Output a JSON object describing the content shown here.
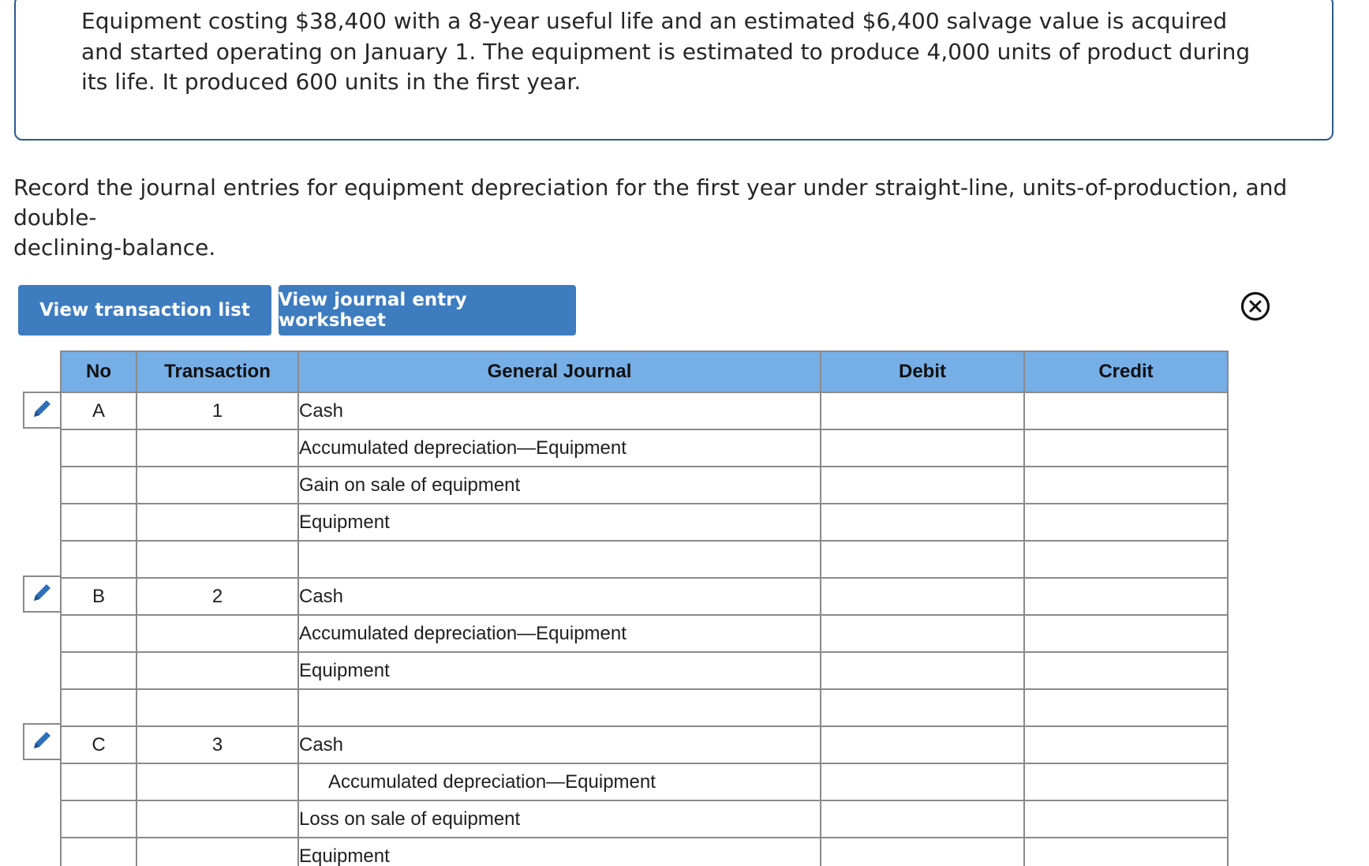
{
  "problem": {
    "lines": [
      "Equipment costing $38,400 with a 8-year useful life and an estimated $6,400 salvage value is acquired",
      "and started operating on January 1. The equipment is estimated to produce 4,000 units of product during",
      "its life. It produced 600 units in the first year."
    ]
  },
  "instruction": {
    "lines": [
      "Record the journal entries for equipment depreciation for the first year under straight-line, units-of-production, and double-",
      "declining-balance."
    ]
  },
  "buttons": {
    "transaction_list": "View transaction list",
    "journal_worksheet": "View journal entry worksheet"
  },
  "table": {
    "headers": {
      "no": "No",
      "transaction": "Transaction",
      "general_journal": "General Journal",
      "debit": "Debit",
      "credit": "Credit"
    },
    "rows": [
      {
        "no": "A",
        "transaction": "1",
        "account": "Cash",
        "debit": "",
        "credit": ""
      },
      {
        "no": "",
        "transaction": "",
        "account": "Accumulated depreciation—Equipment",
        "debit": "",
        "credit": ""
      },
      {
        "no": "",
        "transaction": "",
        "account": "Gain on sale of equipment",
        "debit": "",
        "credit": ""
      },
      {
        "no": "",
        "transaction": "",
        "account": "Equipment",
        "debit": "",
        "credit": ""
      },
      {
        "no": "",
        "transaction": "",
        "account": "",
        "debit": "",
        "credit": ""
      },
      {
        "no": "B",
        "transaction": "2",
        "account": "Cash",
        "debit": "",
        "credit": ""
      },
      {
        "no": "",
        "transaction": "",
        "account": "Accumulated depreciation—Equipment",
        "debit": "",
        "credit": ""
      },
      {
        "no": "",
        "transaction": "",
        "account": "Equipment",
        "debit": "",
        "credit": ""
      },
      {
        "no": "",
        "transaction": "",
        "account": "",
        "debit": "",
        "credit": ""
      },
      {
        "no": "C",
        "transaction": "3",
        "account": "Cash",
        "debit": "",
        "credit": ""
      },
      {
        "no": "",
        "transaction": "",
        "account": "Accumulated depreciation—Equipment",
        "debit": "",
        "credit": ""
      },
      {
        "no": "",
        "transaction": "",
        "account": "Loss on sale of equipment",
        "debit": "",
        "credit": ""
      },
      {
        "no": "",
        "transaction": "",
        "account": "Equipment",
        "debit": "",
        "credit": ""
      }
    ]
  },
  "icons": {
    "edit": "pencil-icon",
    "close": "close-circle-icon"
  },
  "colors": {
    "button_bg": "#3e7cc0",
    "header_bg": "#76aee6",
    "edit_icon": "#2f6fb8",
    "box_border": "#2a5a8c"
  }
}
